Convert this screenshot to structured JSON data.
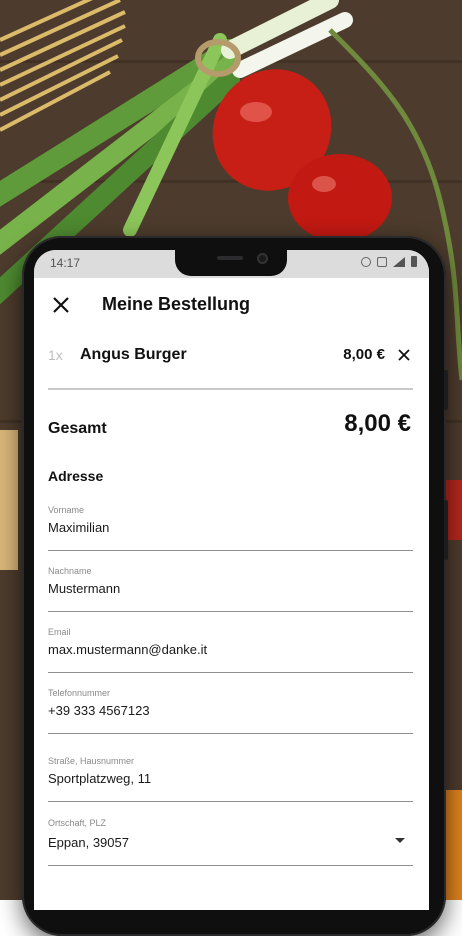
{
  "status_bar": {
    "time": "14:17"
  },
  "header": {
    "title": "Meine Bestellung"
  },
  "order_item": {
    "quantity": "1x",
    "name": "Angus Burger",
    "price": "8,00 €"
  },
  "total": {
    "label": "Gesamt",
    "value": "8,00 €"
  },
  "address": {
    "section_title": "Adresse",
    "fields": [
      {
        "label": "Vorname",
        "value": "Maximilian"
      },
      {
        "label": "Nachname",
        "value": "Mustermann"
      },
      {
        "label": "Email",
        "value": "max.mustermann@danke.it"
      },
      {
        "label": "Telefonnummer",
        "value": "+39 333 4567123"
      },
      {
        "label": "Straße, Hausnummer",
        "value": "Sportplatzweg, 11"
      },
      {
        "label": "Ortschaft, PLZ",
        "value": "Eppan, 39057"
      }
    ]
  },
  "icons": [
    "close-icon",
    "remove-item-icon",
    "dropdown-arrow-icon",
    "alarm-icon",
    "vibrate-icon",
    "signal-icon",
    "battery-icon"
  ]
}
